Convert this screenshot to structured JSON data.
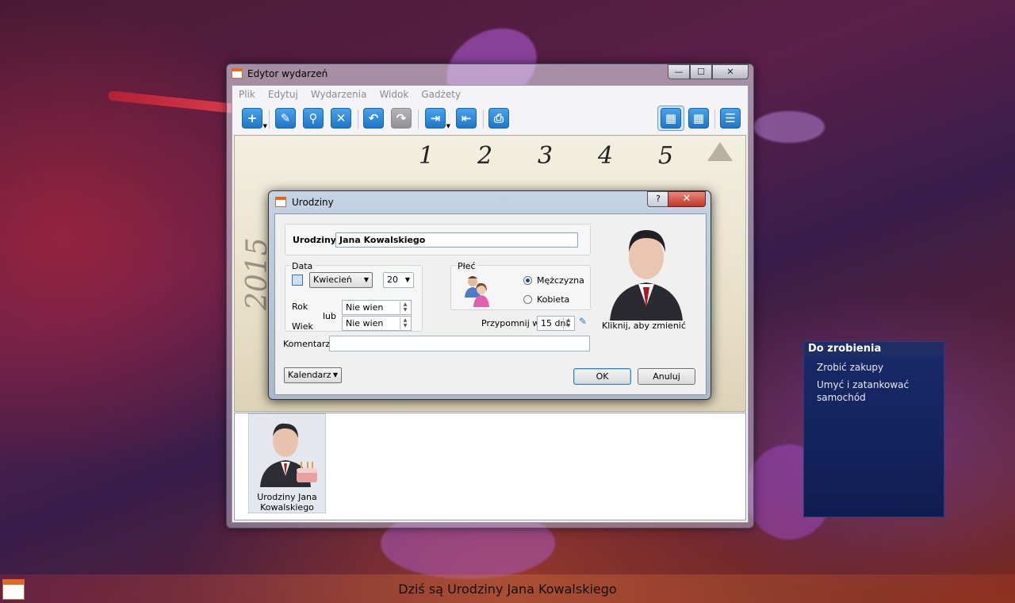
{
  "window": {
    "title": "Edytor wydarzeń",
    "controls": {
      "minimize": "—",
      "maximize": "☐",
      "close": "✕"
    }
  },
  "menu": [
    "Plik",
    "Edytuj",
    "Wydarzenia",
    "Widok",
    "Gadżety"
  ],
  "toolbar": [
    {
      "name": "add",
      "glyph": "+",
      "enabled": true
    },
    {
      "name": "edit",
      "glyph": "✎",
      "enabled": true
    },
    {
      "name": "find",
      "glyph": "⚲",
      "enabled": true
    },
    {
      "name": "delete",
      "glyph": "✕",
      "enabled": true
    },
    {
      "name": "undo",
      "glyph": "↶",
      "enabled": true
    },
    {
      "name": "redo",
      "glyph": "↷",
      "enabled": false
    },
    {
      "name": "export",
      "glyph": "⇥",
      "enabled": true
    },
    {
      "name": "import",
      "glyph": "⇤",
      "enabled": true
    },
    {
      "name": "print",
      "glyph": "⎙",
      "enabled": true
    },
    {
      "name": "month-view",
      "glyph": "▦",
      "enabled": true,
      "active": true
    },
    {
      "name": "week-view",
      "glyph": "▦",
      "enabled": true
    },
    {
      "name": "tree-view",
      "glyph": "☰",
      "enabled": true
    }
  ],
  "calendar": {
    "numbers": [
      "1",
      "2",
      "3",
      "4",
      "5"
    ],
    "year": "2015"
  },
  "event_tile": {
    "label_line1": "Urodziny Jana",
    "label_line2": "Kowalskiego"
  },
  "dialog": {
    "title": "Urodziny",
    "help": "?",
    "close": "✕",
    "name_label": "Urodziny",
    "name_value": "Jana Kowalskiego",
    "date_group": "Data",
    "month": "Kwiecień",
    "day": "20",
    "year_label": "Rok",
    "or_label": "lub",
    "age_label": "Wiek",
    "year_value": "Nie wien",
    "age_value": "Nie wien",
    "gender_group": "Płeć",
    "male": "Mężczyzna",
    "female": "Kobieta",
    "gender_selected": "male",
    "remind_label": "Przypomnij w",
    "remind_value": "15 dni",
    "avatar_caption": "Kliknij, aby zmienić",
    "comment_label": "Komentarz",
    "comment_value": "",
    "calendar_button": "Kalendarz",
    "ok": "OK",
    "cancel": "Anuluj"
  },
  "todo": {
    "title": "Do zrobienia",
    "items": [
      "Zrobić zakupy",
      "Umyć i zatankować samochód"
    ]
  },
  "status": {
    "text": "Dziś są Urodziny Jana Kowalskiego"
  }
}
